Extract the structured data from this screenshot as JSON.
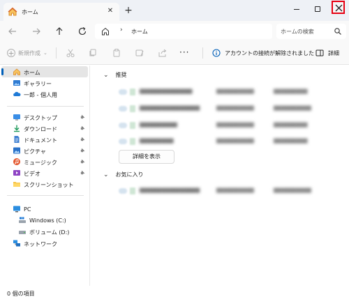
{
  "window": {
    "tab_title": "ホーム",
    "tab_close": "✕",
    "new_tab": "+"
  },
  "address": {
    "separator": "›",
    "crumb": "ホーム",
    "search_placeholder": "ホームの検索"
  },
  "toolbar": {
    "new_label": "新規作成",
    "new_plus": "+",
    "new_chevron": "⌄",
    "more": "···",
    "info_text": "アカウントの接続が解除されました",
    "details_label": "詳細"
  },
  "sidebar": {
    "items": [
      {
        "label": "ホーム",
        "icon": "home-icon"
      },
      {
        "label": "ギャラリー",
        "icon": "gallery-icon"
      },
      {
        "label": "一郎 - 個人用",
        "icon": "onedrive-cloud-icon"
      },
      {
        "label": "デスクトップ",
        "icon": "desktop-icon",
        "pinned": true
      },
      {
        "label": "ダウンロード",
        "icon": "download-icon",
        "pinned": true
      },
      {
        "label": "ドキュメント",
        "icon": "documents-icon",
        "pinned": true
      },
      {
        "label": "ピクチャ",
        "icon": "pictures-icon",
        "pinned": true
      },
      {
        "label": "ミュージック",
        "icon": "music-icon",
        "pinned": true
      },
      {
        "label": "ビデオ",
        "icon": "videos-icon",
        "pinned": true
      },
      {
        "label": "スクリーンショット",
        "icon": "folder-icon"
      },
      {
        "label": "PC",
        "icon": "pc-icon"
      },
      {
        "label": "Windows (C:)",
        "icon": "drive-icon"
      },
      {
        "label": "ボリューム (D:)",
        "icon": "drive-icon"
      },
      {
        "label": "ネットワーク",
        "icon": "network-icon"
      }
    ],
    "pin_glyph": "📌"
  },
  "main": {
    "recommended_label": "推奨",
    "show_more_label": "詳細を表示",
    "favorites_label": "お気に入り",
    "chevron": "⌄"
  },
  "status": {
    "item_count": "0 個の項目"
  },
  "colors": {
    "accent": "#005fb8",
    "close_highlight": "#e60012"
  }
}
